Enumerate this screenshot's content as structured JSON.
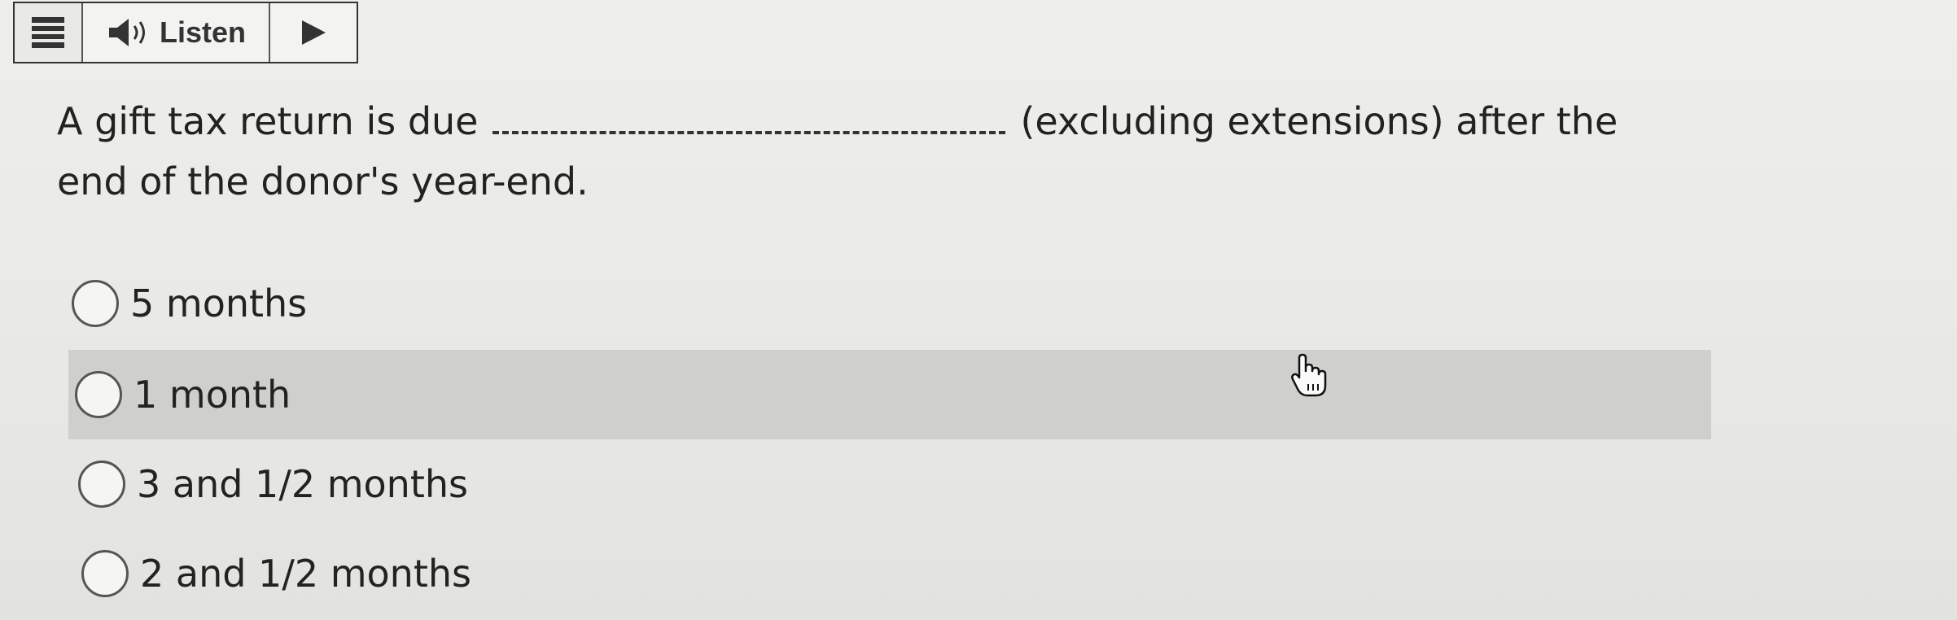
{
  "toolbar": {
    "menu_icon": "hamburger-menu-icon",
    "listen_icon": "speaker-icon",
    "listen_label": "Listen",
    "play_icon": "play-icon"
  },
  "question": {
    "before_blank": "A gift tax return is due",
    "after_blank": "(excluding extensions) after the end of the donor's year-end."
  },
  "options": [
    {
      "label": "5 months"
    },
    {
      "label": "1 month"
    },
    {
      "label": "3 and 1/2 months"
    },
    {
      "label": "2 and 1/2 months"
    }
  ],
  "colors": {
    "background": "#ebebe8",
    "hover_row": "#cfcfcc",
    "text": "#222222"
  },
  "cursor": "hand-pointer-icon"
}
